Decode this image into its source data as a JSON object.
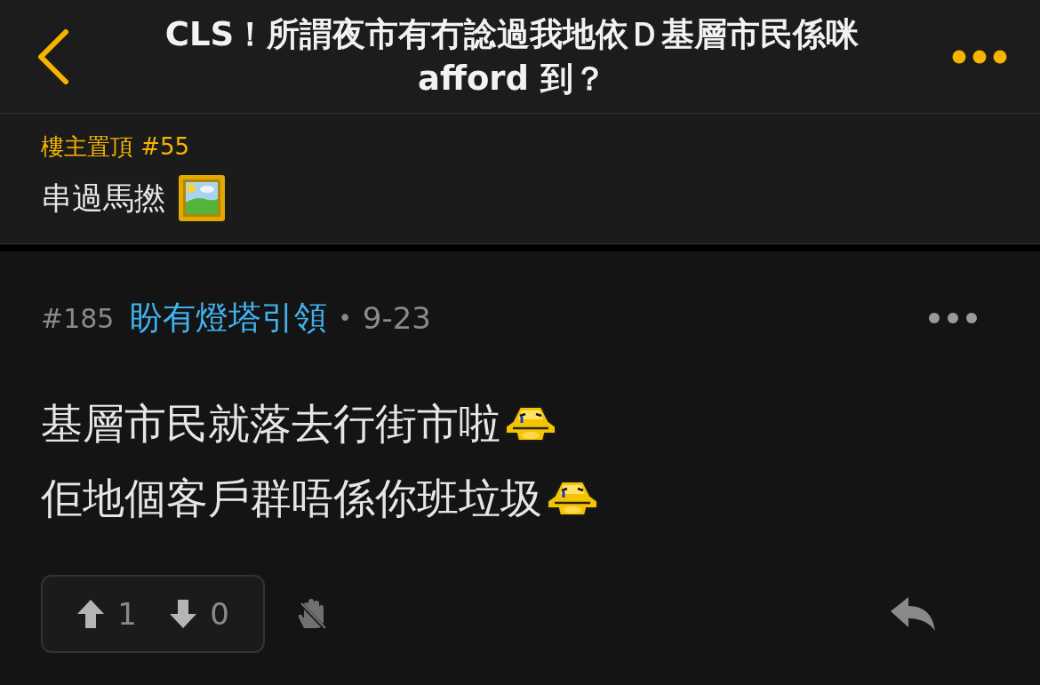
{
  "header": {
    "title": "CLS！所謂夜市有冇諗過我地依Ｄ基層市民係咪 afford 到？"
  },
  "pinned": {
    "label": "樓主置頂 #55",
    "text": "串過馬撚"
  },
  "post": {
    "number": "#185",
    "author": "盼有燈塔引領",
    "separator": "•",
    "date": "9-23",
    "lines": [
      "基層市民就落去行街市啦",
      "佢地個客戶群唔係你班垃圾"
    ],
    "upvotes": "1",
    "downvotes": "0"
  }
}
